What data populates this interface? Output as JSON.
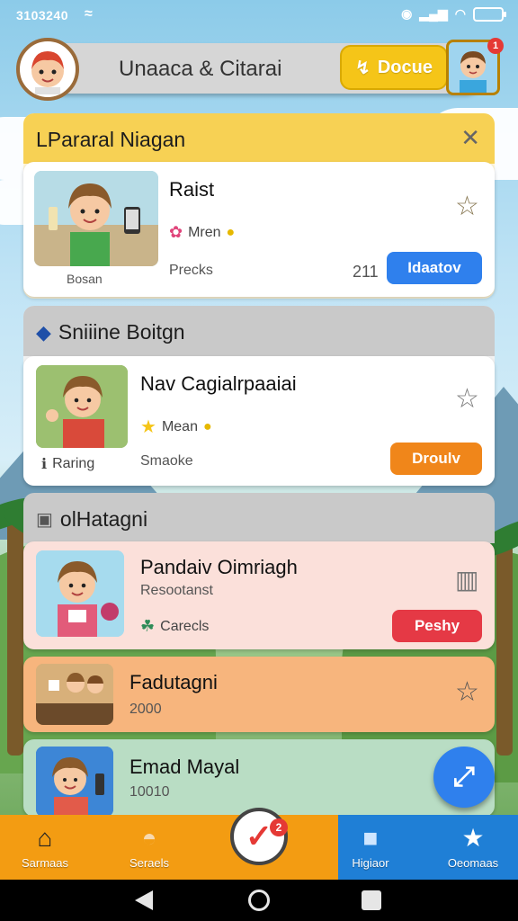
{
  "status_bar": {
    "time": "3103240"
  },
  "header": {
    "title": "Unaaca & Citarai",
    "daily_button": "Docue",
    "notification_badge": "1"
  },
  "sections": [
    {
      "title": "LPararal Niagan",
      "color": "#f7d154",
      "cards": [
        {
          "name": "Raist",
          "subtitle": "Mren",
          "thumb_caption": "Bosan",
          "meta_label": "Precks",
          "meta_value": "211",
          "button": "Idaatov",
          "button_color": "#2f80ed"
        }
      ]
    },
    {
      "title": "Sniiine Boitgn",
      "color": "#c9c9c9",
      "cards": [
        {
          "name": "Nav Cagialrpaaiai",
          "subtitle": "Mean",
          "thumb_caption": "Raring",
          "meta_label": "Smaoke",
          "button": "Droulv",
          "button_color": "#f0861a"
        }
      ]
    },
    {
      "title": "olHatagni",
      "color": "#c9c9c9",
      "cards": [
        {
          "name": "Pandaiv Oimriagh",
          "subtitle": "Resootanst",
          "meta_label": "Carecls",
          "button": "Peshy",
          "button_color": "#e53945"
        },
        {
          "name": "Fadutagni",
          "subtitle": "2000"
        },
        {
          "name": "Emad Mayal",
          "subtitle": "10010"
        }
      ]
    }
  ],
  "bottom_nav": {
    "items": [
      {
        "label": "Sarmaas",
        "icon": "home-icon"
      },
      {
        "label": "Seraels",
        "icon": "bag-icon"
      },
      {
        "label": "Higiaor",
        "icon": "chat-icon"
      },
      {
        "label": "Oeomaas",
        "icon": "star-icon"
      }
    ],
    "center_badge": "2"
  }
}
